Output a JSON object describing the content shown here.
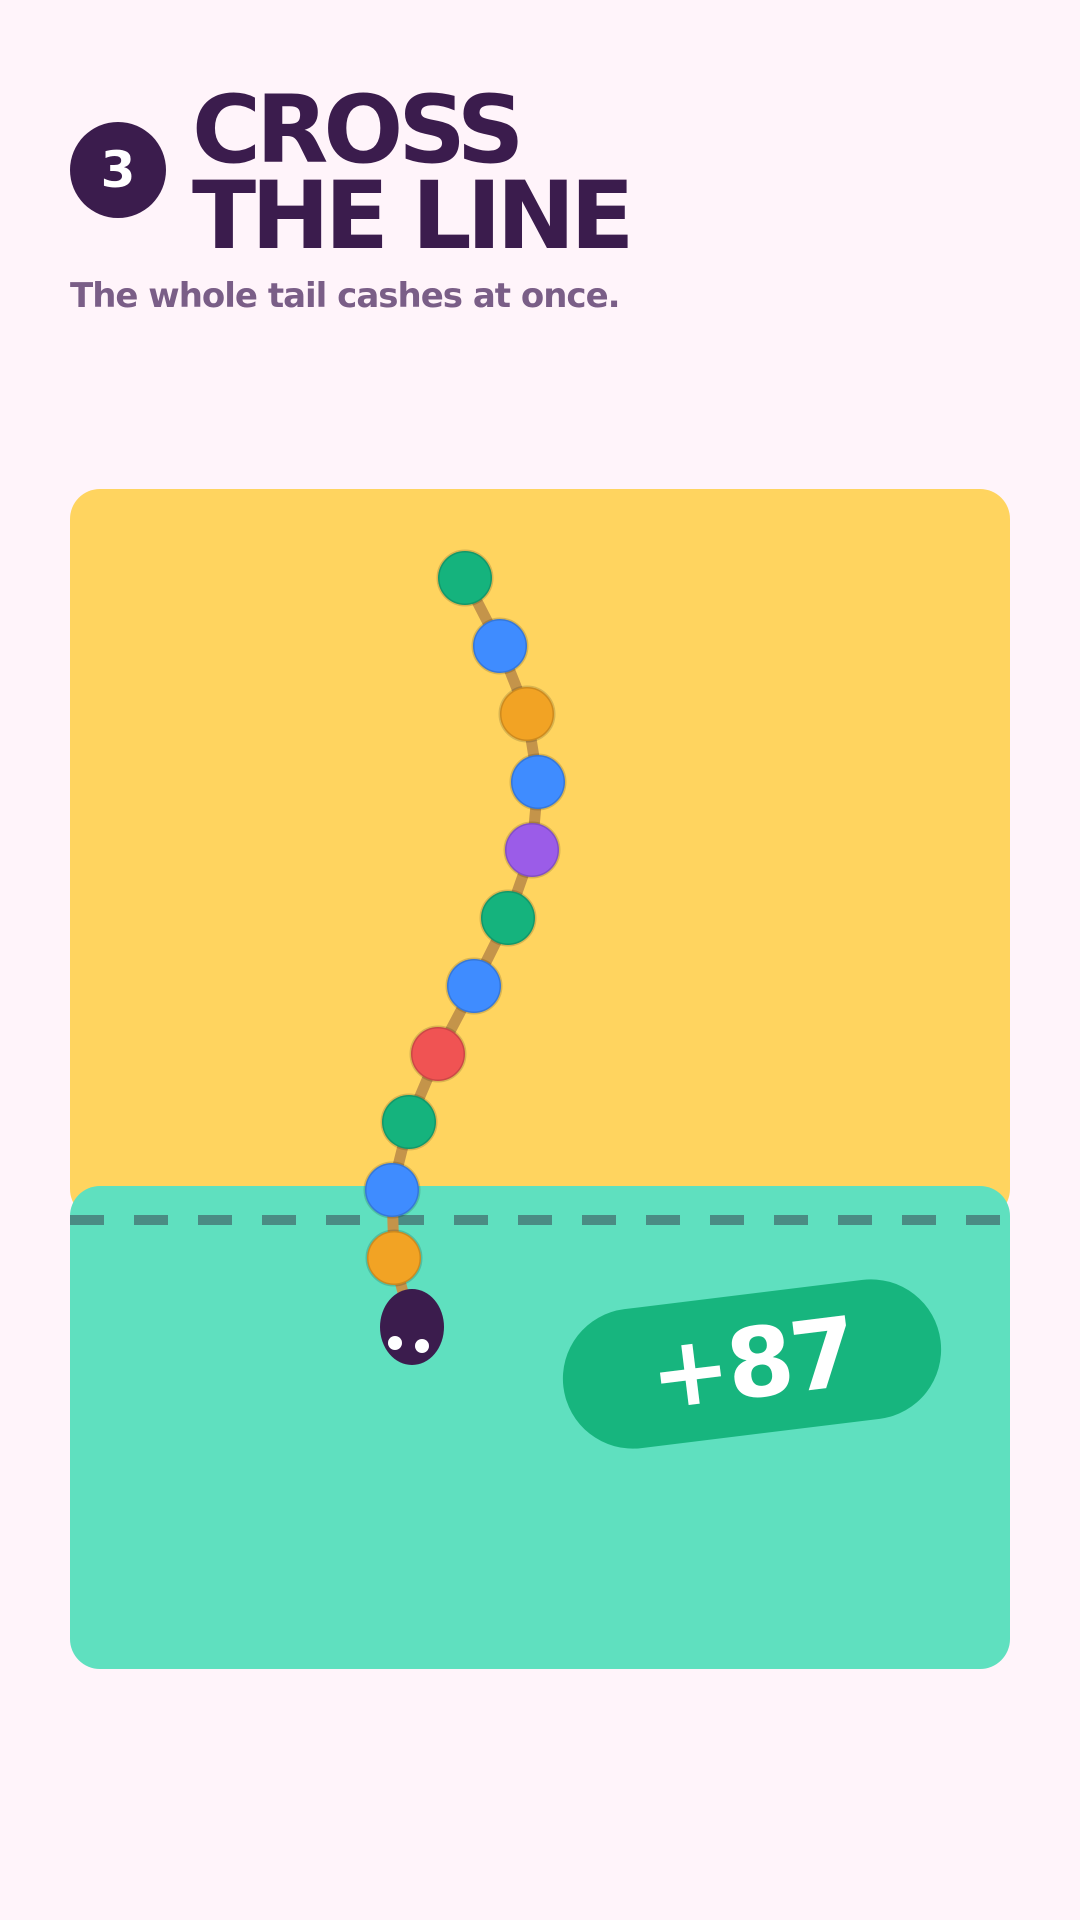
{
  "header": {
    "step_number": "3",
    "title_line1": "CROSS",
    "title_line2": "THE LINE",
    "subtitle": "The whole tail cashes at once."
  },
  "game": {
    "score_popup": "+87",
    "colors": {
      "background": "#fff4fa",
      "top_zone": "#ffd45f",
      "bottom_zone": "#5fe0bf",
      "finish_line": "#4a8c84",
      "score_pill": "#17b57e",
      "snake_head": "#3b1c4d",
      "tail_link": "#c4944a"
    },
    "tail_segment_colors": [
      "#15b37d",
      "#3f8cff",
      "#f2a324",
      "#3f8cff",
      "#9b5ce8",
      "#15b37d",
      "#3f8cff",
      "#f05353",
      "#15b37d",
      "#3f8cff",
      "#f2a324"
    ]
  }
}
